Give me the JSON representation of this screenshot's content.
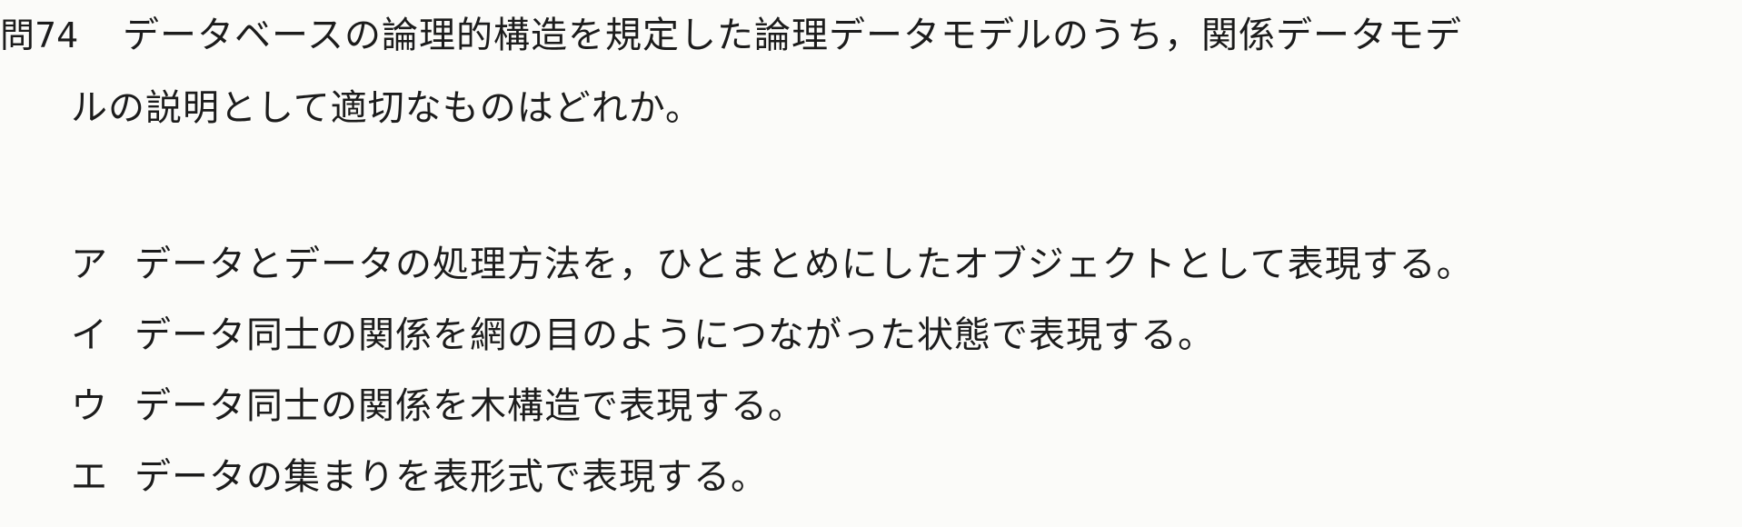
{
  "question": {
    "number": "問74",
    "line1": "データベースの論理的構造を規定した論理データモデルのうち，関係データモデ",
    "line2": "ルの説明として適切なものはどれか。"
  },
  "choices": [
    {
      "label": "ア",
      "text": "データとデータの処理方法を，ひとまとめにしたオブジェクトとして表現する。"
    },
    {
      "label": "イ",
      "text": "データ同士の関係を網の目のようにつながった状態で表現する。"
    },
    {
      "label": "ウ",
      "text": "データ同士の関係を木構造で表現する。"
    },
    {
      "label": "エ",
      "text": "データの集まりを表形式で表現する。"
    }
  ]
}
